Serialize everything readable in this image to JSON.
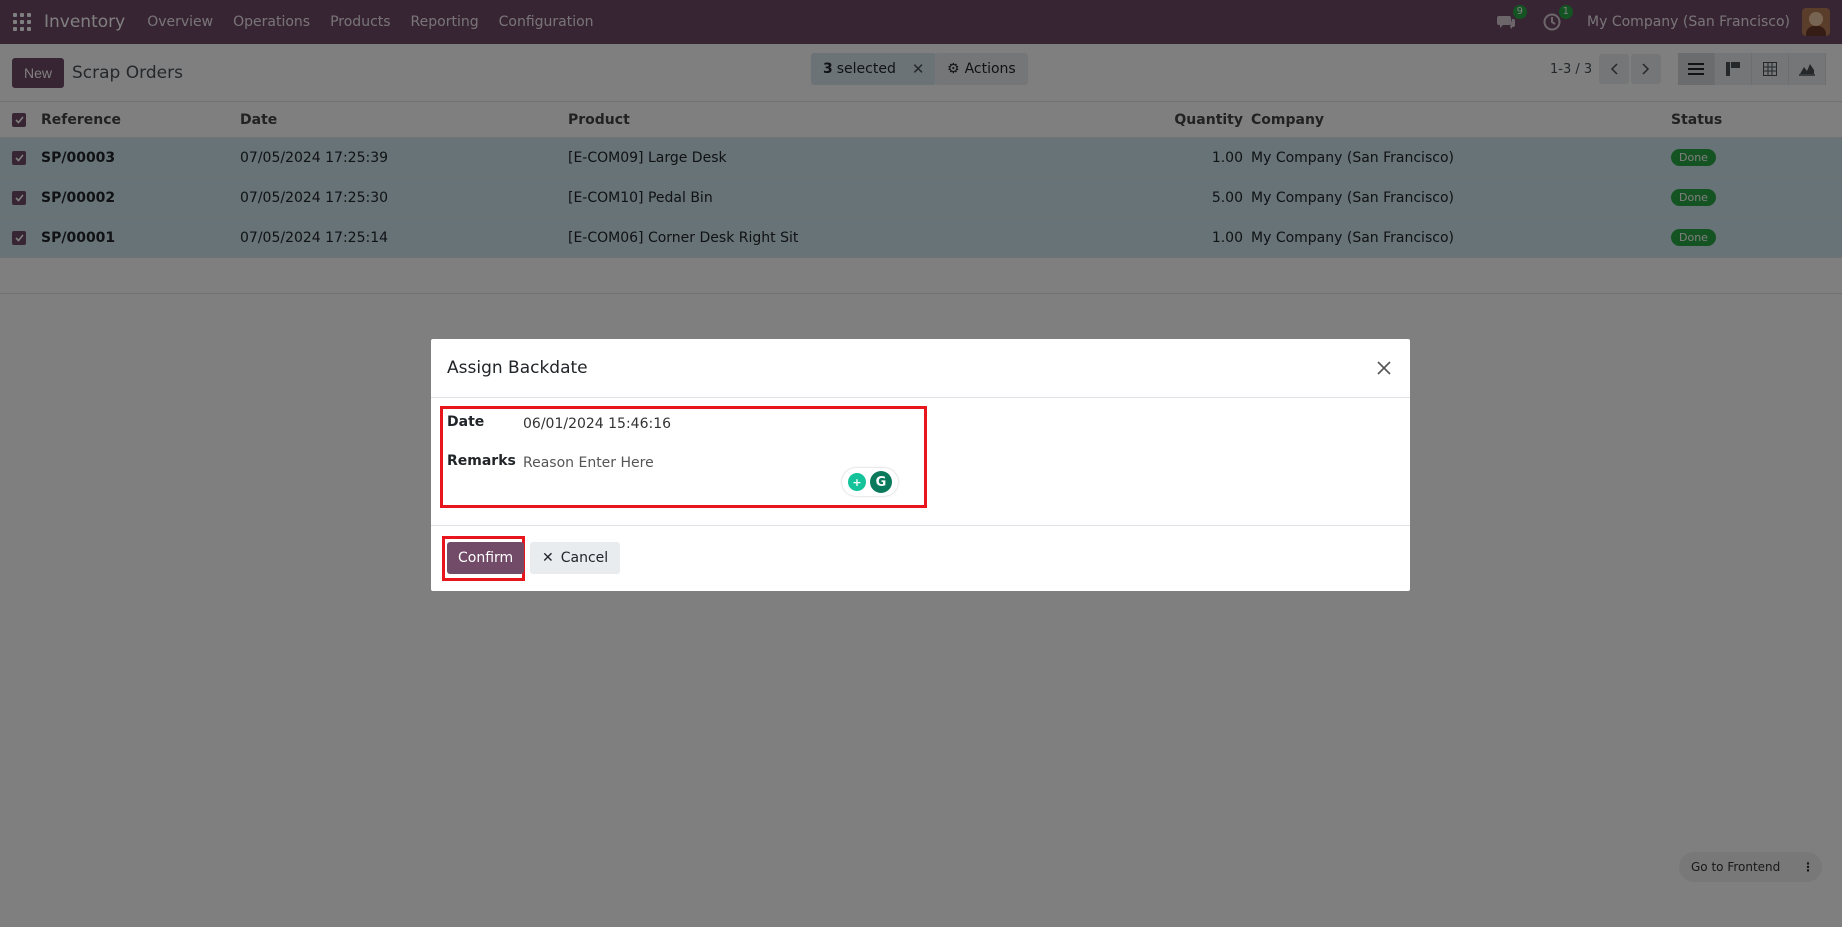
{
  "navbar": {
    "app_name": "Inventory",
    "menu": [
      "Overview",
      "Operations",
      "Products",
      "Reporting",
      "Configuration"
    ],
    "messages_badge": "9",
    "activities_badge": "1",
    "company": "My Company (San Francisco)"
  },
  "control_panel": {
    "new_label": "New",
    "title": "Scrap Orders",
    "selected_count": "3",
    "selected_label": "selected",
    "actions_label": "Actions",
    "pager": "1-3 / 3"
  },
  "list": {
    "columns": [
      "Reference",
      "Date",
      "Product",
      "Quantity",
      "Company",
      "Status"
    ],
    "rows": [
      {
        "reference": "SP/00003",
        "date": "07/05/2024 17:25:39",
        "product": "[E-COM09] Large Desk",
        "quantity": "1.00",
        "company": "My Company (San Francisco)",
        "status": "Done"
      },
      {
        "reference": "SP/00002",
        "date": "07/05/2024 17:25:30",
        "product": "[E-COM10] Pedal Bin",
        "quantity": "5.00",
        "company": "My Company (San Francisco)",
        "status": "Done"
      },
      {
        "reference": "SP/00001",
        "date": "07/05/2024 17:25:14",
        "product": "[E-COM06] Corner Desk Right Sit",
        "quantity": "1.00",
        "company": "My Company (San Francisco)",
        "status": "Done"
      }
    ]
  },
  "dialog": {
    "title": "Assign Backdate",
    "date_label": "Date",
    "date_value": "06/01/2024 15:46:16",
    "remarks_label": "Remarks",
    "remarks_placeholder": "Reason Enter Here",
    "confirm_label": "Confirm",
    "cancel_label": "Cancel"
  },
  "frontend_label": "Go to Frontend",
  "colors": {
    "brand": "#714B67",
    "selected_row": "#cfe6ef",
    "status_done": "#28a745",
    "highlight": "#e8151c"
  }
}
